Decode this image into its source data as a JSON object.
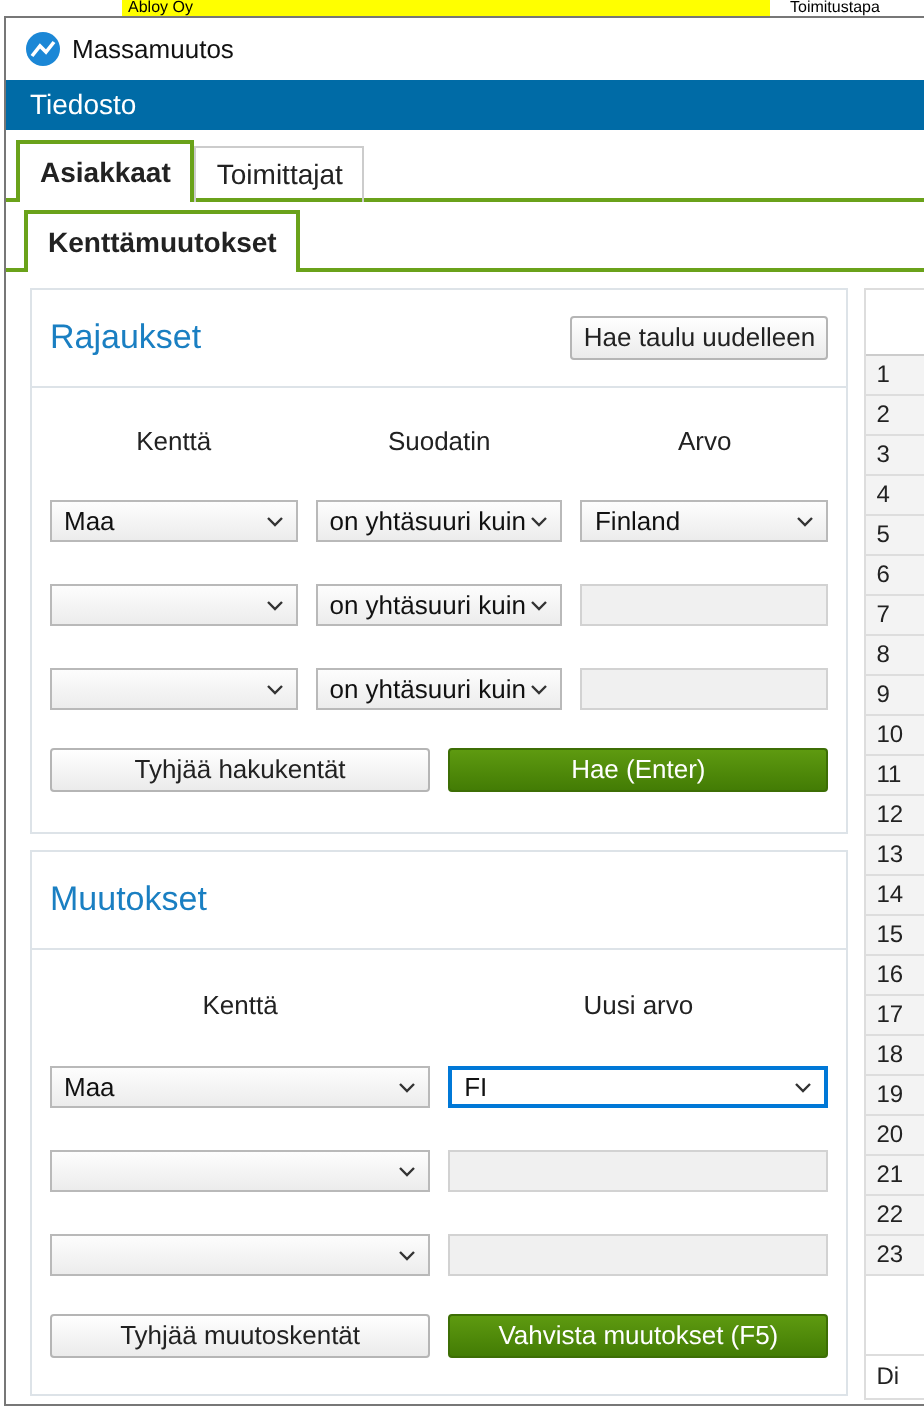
{
  "background": {
    "highlighted_cell": "Abloy Oy",
    "column_header": "Toimitustapa"
  },
  "window": {
    "title": "Massamuutos"
  },
  "menu": [
    "Tiedosto"
  ],
  "tabs": [
    {
      "label": "Asiakkaat",
      "selected": true
    },
    {
      "label": "Toimittajat",
      "selected": false
    }
  ],
  "subtabs": [
    {
      "label": "Kenttämuutokset",
      "selected": true
    }
  ],
  "filters": {
    "title": "Rajaukset",
    "refresh_button": "Hae taulu uudelleen",
    "columns": [
      "Kenttä",
      "Suodatin",
      "Arvo"
    ],
    "rows": [
      {
        "field": "Maa",
        "operator": "on yhtäsuuri kuin",
        "value": "Finland",
        "kind": "select"
      },
      {
        "operator": "on yhtäsuuri kuin",
        "kind": "text"
      },
      {
        "operator": "on yhtäsuuri kuin",
        "kind": "text"
      }
    ],
    "clear_button": "Tyhjää hakukentät",
    "search_button": "Hae (Enter)"
  },
  "changes": {
    "title": "Muutokset",
    "columns": [
      "Kenttä",
      "Uusi arvo"
    ],
    "rows": [
      {
        "field": "Maa",
        "value": "FI",
        "kind": "select",
        "focused": true
      },
      {
        "kind": "text",
        "focused": false
      },
      {
        "kind": "text",
        "focused": false
      }
    ],
    "clear_button": "Tyhjää muutoskentät",
    "confirm_button": "Vahvista muutokset (F5)"
  },
  "side_grid": {
    "row_numbers": [
      "1",
      "2",
      "3",
      "4",
      "5",
      "6",
      "7",
      "8",
      "9",
      "10",
      "11",
      "12",
      "13",
      "14",
      "15",
      "16",
      "17",
      "18",
      "19",
      "20",
      "21",
      "22",
      "23"
    ],
    "footer": "Di"
  }
}
